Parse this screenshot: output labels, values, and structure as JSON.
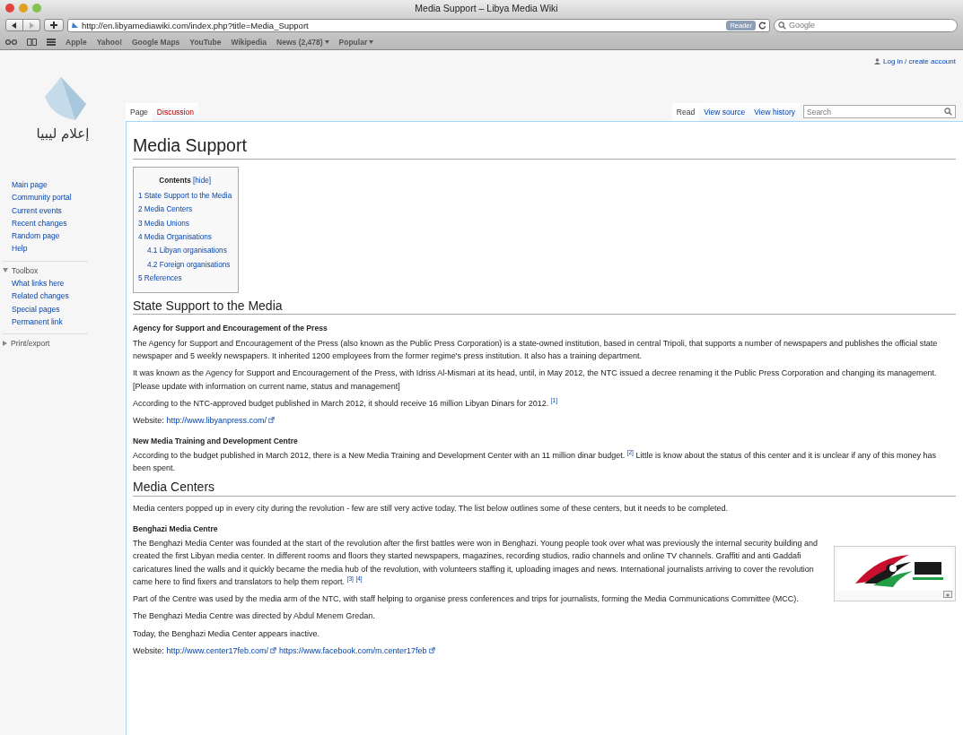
{
  "window": {
    "title": "Media Support – Libya Media Wiki"
  },
  "toolbar": {
    "url": "http://en.libyamediawiki.com/index.php?title=Media_Support",
    "reader_button": "Reader",
    "search_placeholder": "Google"
  },
  "bookmarks": [
    {
      "label": "Apple",
      "menu": false
    },
    {
      "label": "Yahoo!",
      "menu": false
    },
    {
      "label": "Google Maps",
      "menu": false
    },
    {
      "label": "YouTube",
      "menu": false
    },
    {
      "label": "Wikipedia",
      "menu": false
    },
    {
      "label": "News (2,478)",
      "menu": true
    },
    {
      "label": "Popular",
      "menu": true
    }
  ],
  "personal_tools": "Log in / create account",
  "logo": {
    "text": "إعلام ليبيا"
  },
  "sidebar": {
    "navigation": [
      "Main page",
      "Community portal",
      "Current events",
      "Recent changes",
      "Random page",
      "Help"
    ],
    "portals": [
      {
        "label": "Toolbox",
        "expanded": true,
        "children": [
          "What links here",
          "Related changes",
          "Special pages",
          "Permanent link"
        ]
      },
      {
        "label": "Print/export",
        "expanded": false
      }
    ]
  },
  "left_tabs": [
    {
      "label": "Page",
      "selected": true,
      "missing": false
    },
    {
      "label": "Discussion",
      "selected": false,
      "missing": true
    }
  ],
  "right_tabs": [
    {
      "label": "Read",
      "selected": true
    },
    {
      "label": "View source",
      "selected": false
    },
    {
      "label": "View history",
      "selected": false
    }
  ],
  "search": {
    "placeholder": "Search"
  },
  "article": {
    "title": "Media Support",
    "toc": {
      "title": "Contents",
      "toggle": "[hide]",
      "items": [
        {
          "number": "1",
          "label": "State Support to the Media"
        },
        {
          "number": "2",
          "label": "Media Centers"
        },
        {
          "number": "3",
          "label": "Media Unions"
        },
        {
          "number": "4",
          "label": "Media Organisations",
          "children": [
            {
              "number": "4.1",
              "label": "Libyan organisations"
            },
            {
              "number": "4.2",
              "label": "Foreign organisations"
            }
          ]
        },
        {
          "number": "5",
          "label": "References"
        }
      ]
    },
    "blocks": [
      {
        "kind": "h2",
        "text": "State Support to the Media"
      },
      {
        "kind": "h3",
        "text": "Agency for Support and Encouragement of the Press"
      },
      {
        "kind": "p",
        "parts": [
          {
            "kind": "text",
            "text": "The Agency for Support and Encouragement of the Press (also known as the Public Press Corporation) is a state-owned institution, based in central Tripoli, that supports a number of newspapers and publishes the official state newspaper and 5 weekly newspapers. It inherited 1200 employees from the former regime's press institution. It also has a training department."
          }
        ]
      },
      {
        "kind": "p",
        "parts": [
          {
            "kind": "text",
            "text": "It was known as the Agency for Support and Encouragement of the Press, with Idriss Al-Mismari at its head, until, in May 2012, the NTC issued a decree renaming it the Public Press Corporation and changing its management. [Please update with information on current name, status and management]"
          }
        ]
      },
      {
        "kind": "p",
        "parts": [
          {
            "kind": "text",
            "text": "According to the NTC-approved budget published in March 2012, it should receive 16 million Libyan Dinars for 2012."
          },
          {
            "kind": "ref",
            "text": "[1]"
          }
        ]
      },
      {
        "kind": "p",
        "parts": [
          {
            "kind": "text",
            "text": "Website:"
          },
          {
            "kind": "extlink",
            "text": "http://www.libyanpress.com/"
          }
        ]
      },
      {
        "kind": "h3",
        "text": "New Media Training and Development Centre"
      },
      {
        "kind": "p",
        "parts": [
          {
            "kind": "text",
            "text": "According to the budget published in March 2012, there is a New Media Training and Development Center with an 11 million dinar budget."
          },
          {
            "kind": "ref",
            "text": "[2]"
          },
          {
            "kind": "text",
            "text": "Little is know about the status of this center and it is unclear if any of this money has been spent."
          }
        ]
      },
      {
        "kind": "h2",
        "text": "Media Centers"
      },
      {
        "kind": "p",
        "parts": [
          {
            "kind": "text",
            "text": "Media centers popped up in every city during the revolution - few are still very active today. The list below outlines some of these centers, but it needs to be completed."
          }
        ]
      },
      {
        "kind": "h3",
        "text": "Benghazi Media Centre"
      },
      {
        "kind": "figure"
      },
      {
        "kind": "p",
        "parts": [
          {
            "kind": "text",
            "text": "The Benghazi Media Center was founded at the start of the revolution after the first battles were won in Benghazi. Young people took over what was previously the internal security building and created the first Libyan media center. In different rooms and floors they started newspapers, magazines, recording studios, radio channels and online TV channels. Graffiti and anti Gaddafi caricatures lined the walls and it quickly became the media hub of the revolution, with volunteers staffing it, uploading images and news. International journalists arriving to cover the revolution came here to find fixers and translators to help them report."
          },
          {
            "kind": "ref",
            "text": "[3]"
          },
          {
            "kind": "ref",
            "text": "[4]"
          }
        ]
      },
      {
        "kind": "p",
        "parts": [
          {
            "kind": "text",
            "text": "Part of the Centre was used by the media arm of the NTC, with staff helping to organise press conferences and trips for journalists, forming the Media Communications Committee (MCC)."
          }
        ]
      },
      {
        "kind": "p",
        "parts": [
          {
            "kind": "text",
            "text": "The Benghazi Media Centre was directed by Abdul Menem Gredan."
          }
        ]
      },
      {
        "kind": "p",
        "parts": [
          {
            "kind": "text",
            "text": "Today, the Benghazi Media Center appears inactive."
          }
        ]
      },
      {
        "kind": "p",
        "parts": [
          {
            "kind": "text",
            "text": "Website:"
          },
          {
            "kind": "extlink",
            "text": "http://www.center17feb.com/"
          },
          {
            "kind": "extlink",
            "text": "https://www.facebook.com/m.center17feb"
          }
        ]
      }
    ]
  }
}
